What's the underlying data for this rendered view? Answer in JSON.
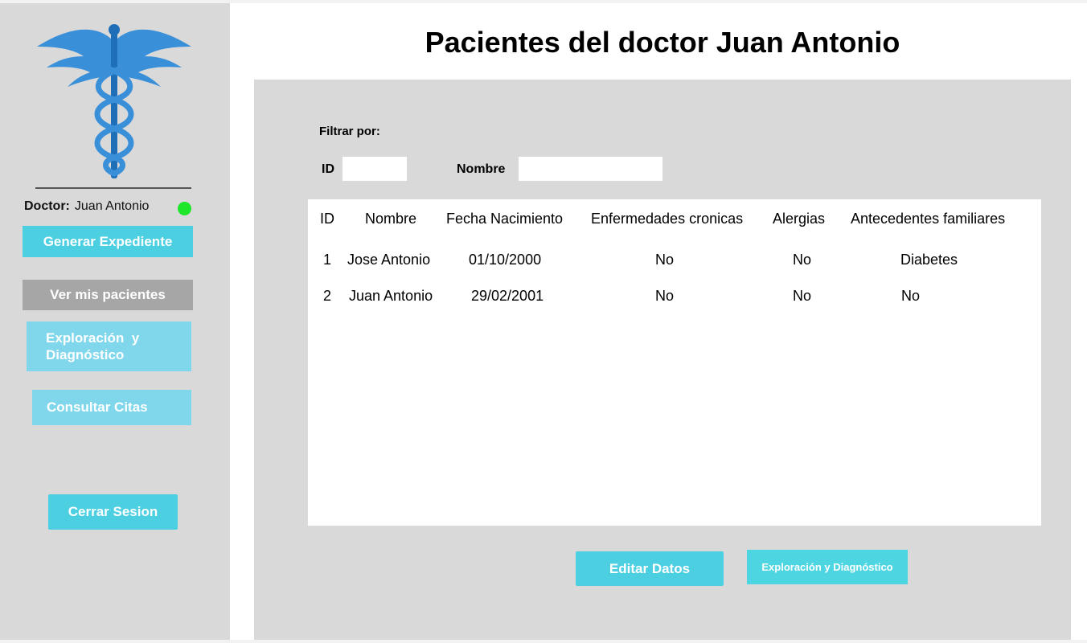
{
  "page": {
    "title": "Pacientes del doctor Juan Antonio"
  },
  "sidebar": {
    "doctor_label": "Doctor:",
    "doctor_name": "Juan Antonio",
    "status_color": "#1ee62a",
    "logo_icon": "caduceus-icon",
    "buttons": {
      "generar": "Generar Expediente",
      "ver_pacientes": "Ver mis pacientes",
      "exploracion": "Exploración  y Diagnóstico",
      "consultar": "Consultar Citas",
      "cerrar": "Cerrar Sesion"
    }
  },
  "filters": {
    "title": "Filtrar por:",
    "id_label": "ID",
    "id_value": "",
    "nombre_label": "Nombre",
    "nombre_value": ""
  },
  "table": {
    "headers": [
      "ID",
      "Nombre",
      "Fecha Nacimiento",
      "Enfermedades cronicas",
      "Alergias",
      "Antecedentes familiares"
    ],
    "rows": [
      [
        "1",
        "Jose Antonio",
        "01/10/2000",
        "No",
        "No",
        "Diabetes"
      ],
      [
        "2",
        "Juan Antonio",
        "29/02/2001",
        "No",
        "No",
        "No"
      ]
    ]
  },
  "actions": {
    "editar": "Editar Datos",
    "exploracion": "Exploración y Diagnóstico"
  },
  "colors": {
    "accent": "#4dcfe2",
    "accent_light": "#80d7eb",
    "selected": "#a6a6a6",
    "panel": "#d9d9d9"
  }
}
